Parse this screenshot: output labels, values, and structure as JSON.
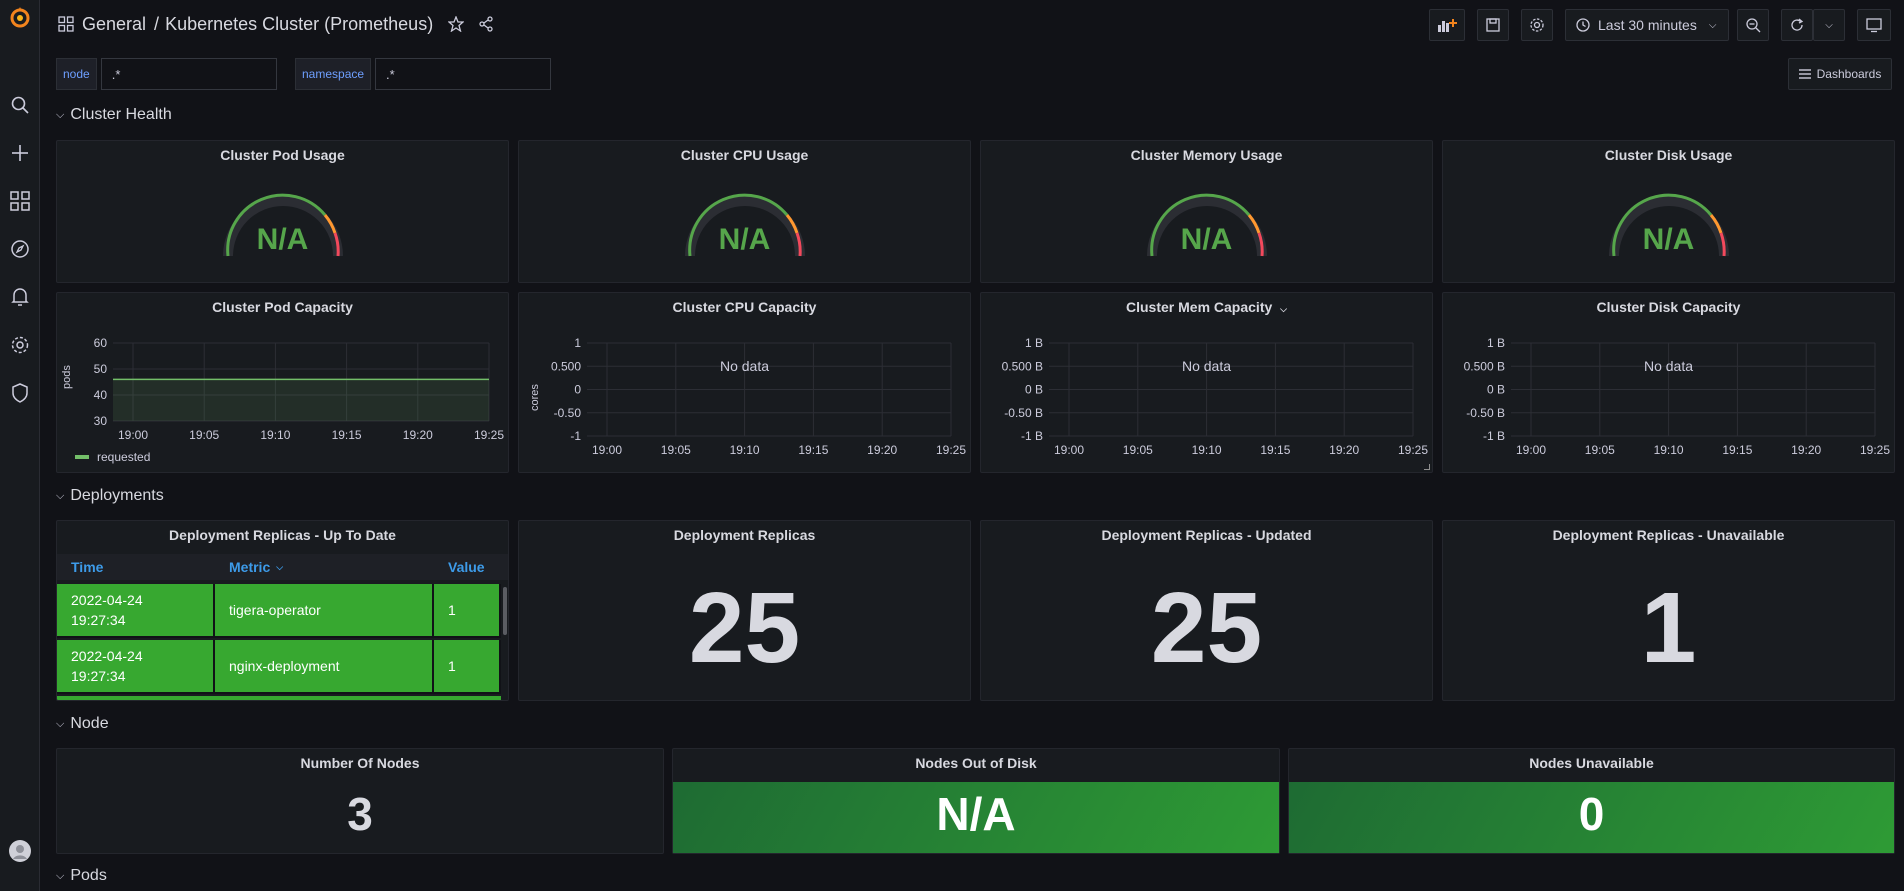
{
  "header": {
    "folder": "General",
    "title": "Kubernetes Cluster (Prometheus)",
    "time_range": "Last 30 minutes"
  },
  "variables": [
    {
      "label": "node",
      "value": ".*"
    },
    {
      "label": "namespace",
      "value": ".*"
    }
  ],
  "dashboards_button": "Dashboards",
  "rows": {
    "cluster_health": "Cluster Health",
    "deployments": "Deployments",
    "node": "Node",
    "pods": "Pods"
  },
  "gauges": [
    {
      "title": "Cluster Pod Usage",
      "value": "N/A"
    },
    {
      "title": "Cluster CPU Usage",
      "value": "N/A"
    },
    {
      "title": "Cluster Memory Usage",
      "value": "N/A"
    },
    {
      "title": "Cluster Disk Usage",
      "value": "N/A"
    }
  ],
  "capacity": {
    "pod": {
      "title": "Cluster Pod Capacity",
      "ylabel": "pods",
      "legend": "requested"
    },
    "cpu": {
      "title": "Cluster CPU Capacity",
      "ylabel": "cores",
      "nodata": "No data"
    },
    "mem": {
      "title": "Cluster Mem Capacity",
      "nodata": "No data"
    },
    "disk": {
      "title": "Cluster Disk Capacity",
      "nodata": "No data"
    }
  },
  "chart_data": [
    {
      "type": "line",
      "title": "Cluster Pod Capacity",
      "ylabel": "pods",
      "x_ticks": [
        "19:00",
        "19:05",
        "19:10",
        "19:15",
        "19:20",
        "19:25"
      ],
      "y_ticks": [
        "60",
        "50",
        "40",
        "30"
      ],
      "ylim": [
        30,
        60
      ],
      "series": [
        {
          "name": "requested",
          "values": [
            46,
            46,
            46,
            46,
            46,
            46,
            46
          ]
        }
      ],
      "grid": true
    },
    {
      "type": "line",
      "title": "Cluster CPU Capacity",
      "ylabel": "cores",
      "x_ticks": [
        "19:00",
        "19:05",
        "19:10",
        "19:15",
        "19:20",
        "19:25"
      ],
      "y_ticks": [
        "1",
        "0.500",
        "0",
        "-0.50",
        "-1"
      ],
      "series": [],
      "grid": true
    },
    {
      "type": "line",
      "title": "Cluster Mem Capacity",
      "x_ticks": [
        "19:00",
        "19:05",
        "19:10",
        "19:15",
        "19:20",
        "19:25"
      ],
      "y_ticks": [
        "1 B",
        "0.500 B",
        "0 B",
        "-0.50 B",
        "-1 B"
      ],
      "series": [],
      "grid": true
    },
    {
      "type": "line",
      "title": "Cluster Disk Capacity",
      "x_ticks": [
        "19:00",
        "19:05",
        "19:10",
        "19:15",
        "19:20",
        "19:25"
      ],
      "y_ticks": [
        "1 B",
        "0.500 B",
        "0 B",
        "-0.50 B",
        "-1 B"
      ],
      "series": [],
      "grid": true
    }
  ],
  "deploy_table": {
    "title": "Deployment Replicas - Up To Date",
    "columns": [
      "Time",
      "Metric",
      "Value"
    ],
    "rows": [
      {
        "time_date": "2022-04-24",
        "time_clock": "19:27:34",
        "metric": "tigera-operator",
        "value": "1"
      },
      {
        "time_date": "2022-04-24",
        "time_clock": "19:27:34",
        "metric": "nginx-deployment",
        "value": "1"
      }
    ]
  },
  "deploy_stats": [
    {
      "title": "Deployment Replicas",
      "value": "25"
    },
    {
      "title": "Deployment Replicas - Updated",
      "value": "25"
    },
    {
      "title": "Deployment Replicas - Unavailable",
      "value": "1"
    }
  ],
  "node_stats": [
    {
      "title": "Number Of Nodes",
      "value": "3"
    },
    {
      "title": "Nodes Out of Disk",
      "value": "N/A"
    },
    {
      "title": "Nodes Unavailable",
      "value": "0"
    }
  ],
  "colors": {
    "accent_blue": "#3d9be9",
    "ok_green": "#56a64b",
    "table_green": "#37a830",
    "warn_orange": "#ff780a"
  }
}
